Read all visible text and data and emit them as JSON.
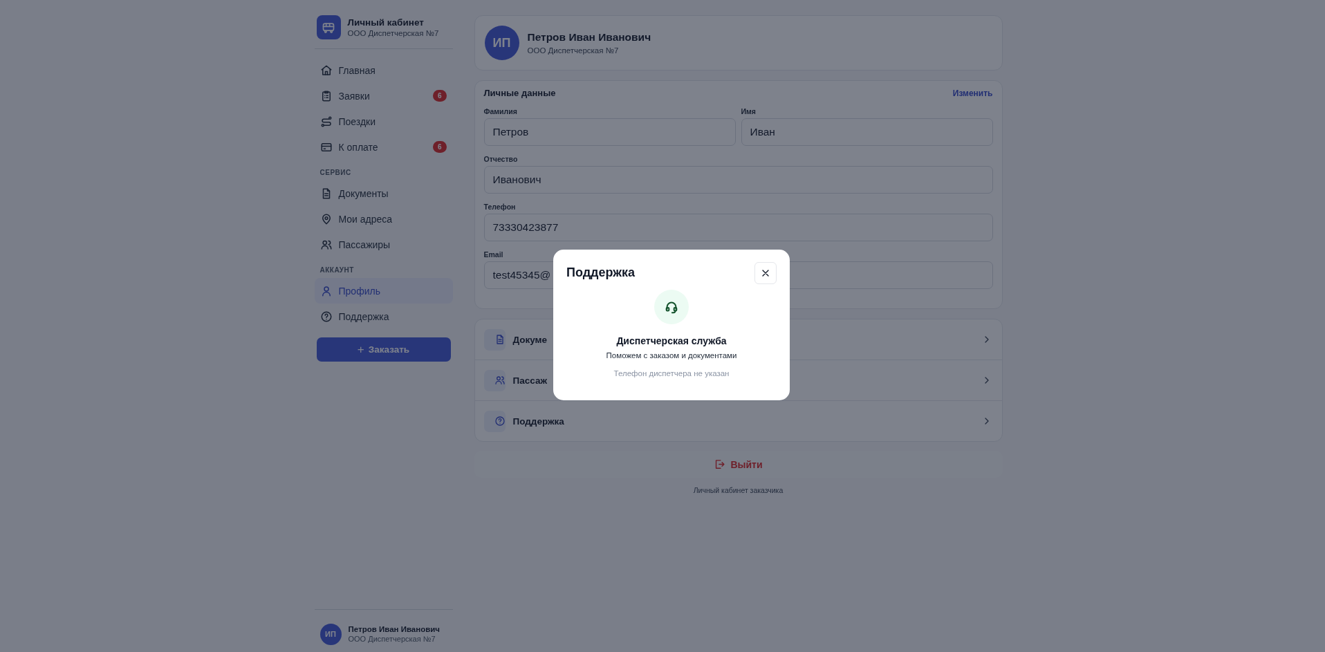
{
  "sidebar": {
    "brand": {
      "title": "Личный кабинет",
      "subtitle": "ООО Диспетчерская №7"
    },
    "sections": [
      {
        "items": [
          {
            "label": "Главная",
            "selected": false
          },
          {
            "label": "Заявки",
            "badge": "6",
            "selected": false
          },
          {
            "label": "Поездки",
            "selected": false
          },
          {
            "label": "К оплате",
            "badge": "6",
            "selected": false
          }
        ]
      },
      {
        "heading": "СЕРВИС",
        "items": [
          {
            "label": "Документы",
            "selected": false
          },
          {
            "label": "Мои адреса",
            "selected": false
          },
          {
            "label": "Пассажиры",
            "selected": false
          }
        ]
      },
      {
        "heading": "АККАУНТ",
        "items": [
          {
            "label": "Профиль",
            "selected": true
          },
          {
            "label": "Поддержка",
            "selected": false
          }
        ]
      }
    ],
    "order_button": {
      "icon": "+",
      "label": "Заказать"
    },
    "user": {
      "initials": "ИП",
      "name": "Петров Иван Иванович",
      "org": "ООО Диспетчерская №7"
    }
  },
  "profile": {
    "initials": "ИП",
    "name": "Петров Иван Иванович",
    "org": "ООО Диспетчерская №7"
  },
  "personal_data": {
    "title": "Личные данные",
    "edit_link": "Изменить",
    "rows": [
      [
        {
          "label": "Фамилия",
          "value": "Петров"
        },
        {
          "label": "Имя",
          "value": "Иван"
        }
      ],
      [
        {
          "label": "Отчество",
          "value": "Иванович"
        }
      ],
      [
        {
          "label": "Телефон",
          "value": "73330423877"
        }
      ],
      [
        {
          "label": "Email",
          "value": "test45345@"
        }
      ]
    ]
  },
  "links": [
    {
      "label": "Докуме"
    },
    {
      "label": "Пассаж"
    },
    {
      "label": "Поддержка"
    }
  ],
  "logout": "Выйти",
  "footer": "Личный кабинет заказчика",
  "modal": {
    "title": "Поддержка",
    "heading": "Диспетчерская служба",
    "subtitle": "Поможем с заказом и документами",
    "note": "Телефон диспетчера не указан"
  }
}
